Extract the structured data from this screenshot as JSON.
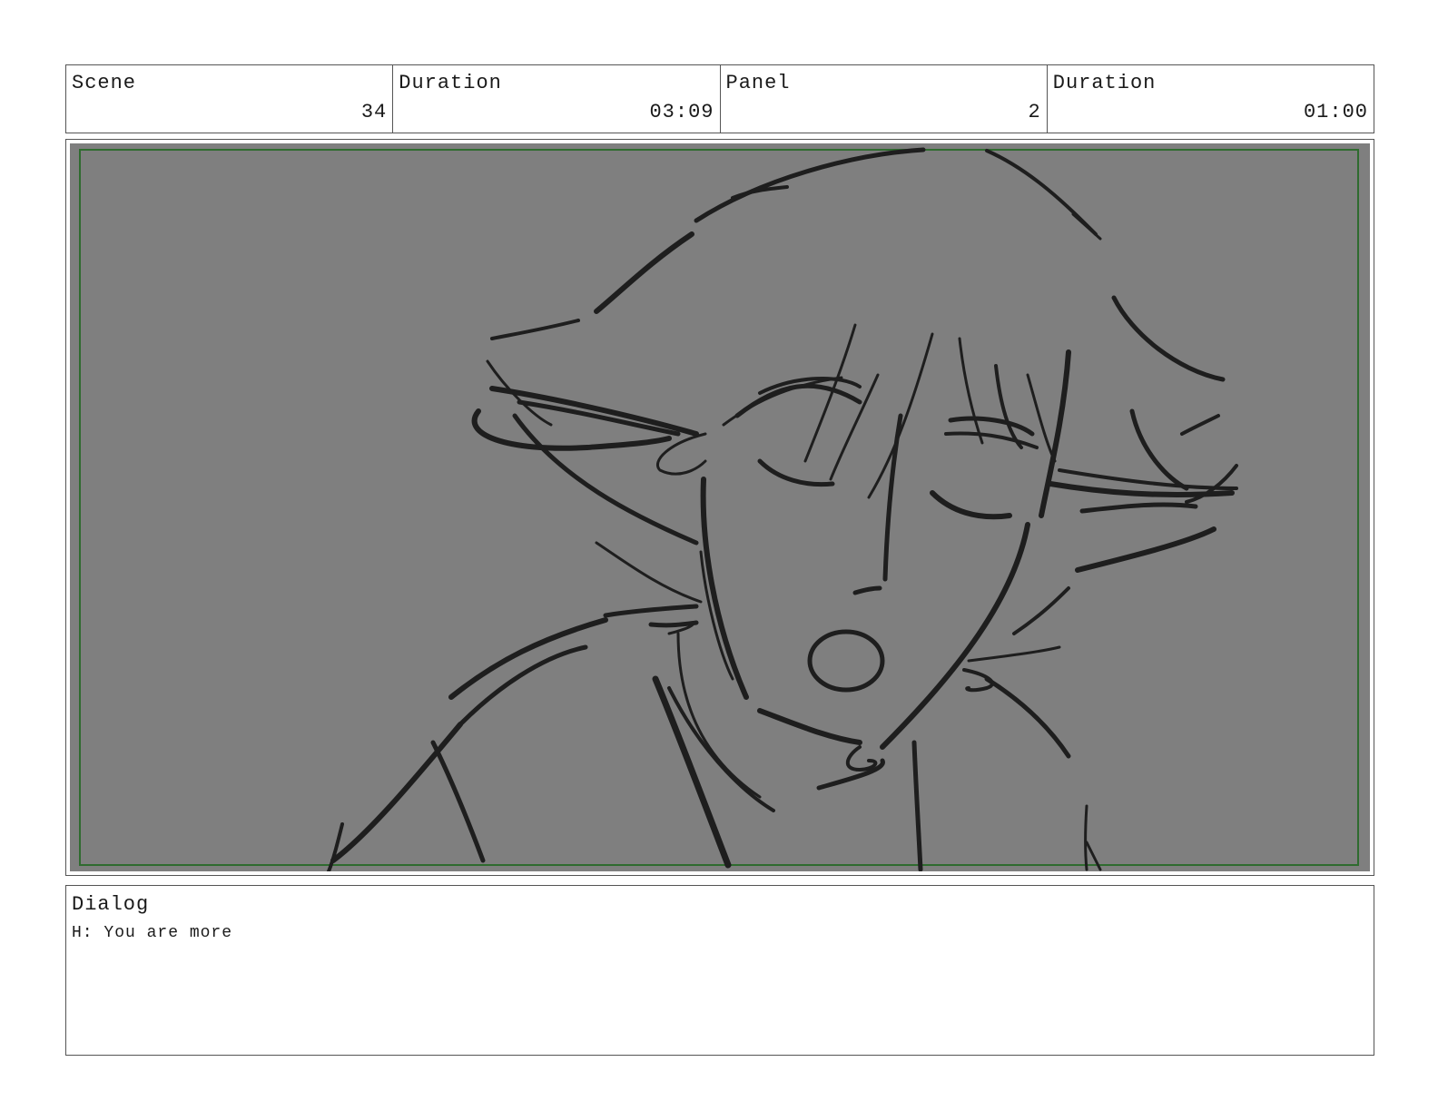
{
  "header": {
    "scene_label": "Scene",
    "scene_value": "34",
    "scene_duration_label": "Duration",
    "scene_duration_value": "03:09",
    "panel_label": "Panel",
    "panel_value": "2",
    "panel_duration_label": "Duration",
    "panel_duration_value": "01:00"
  },
  "panel": {
    "background_color": "#7f7f7f",
    "safe_frame_color": "#2f6b2f",
    "sketch_color": "#1e1e1e",
    "image_description_icon": "sketch-character-singing"
  },
  "dialog": {
    "label": "Dialog",
    "text": "H: You are more"
  }
}
